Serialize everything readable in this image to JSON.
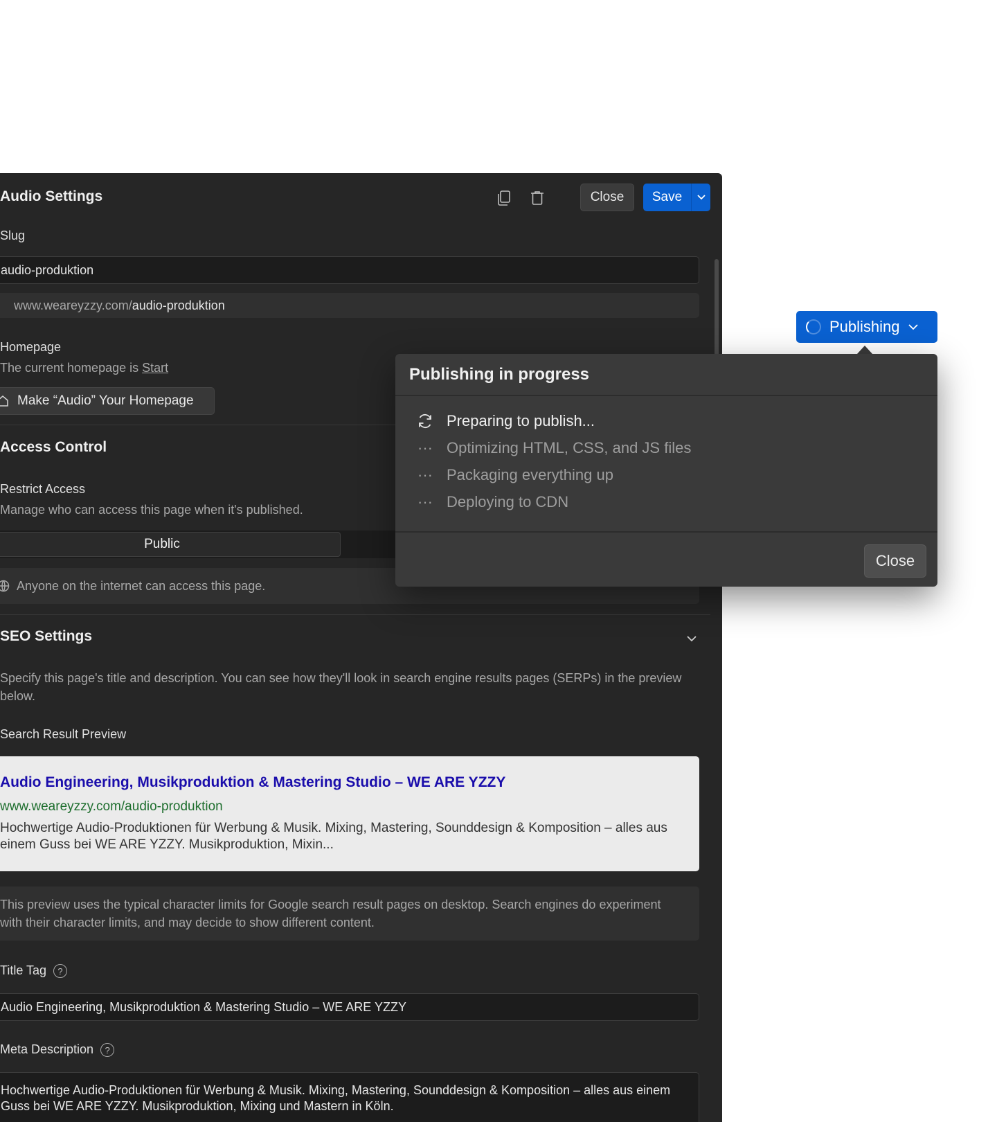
{
  "header": {
    "title": "Audio Settings",
    "close_label": "Close",
    "save_label": "Save"
  },
  "slug": {
    "label": "Slug",
    "value": "audio-produktion",
    "url_base": "www.weareyzzy.com/",
    "url_slug": "audio-produktion"
  },
  "homepage": {
    "label": "Homepage",
    "current_prefix": "The current homepage is ",
    "current_page": "Start",
    "make_button": "Make “Audio” Your Homepage"
  },
  "access": {
    "title": "Access Control",
    "restrict_label": "Restrict Access",
    "restrict_help": "Manage who can access this page when it's published.",
    "option_public": "Public",
    "info": "Anyone on the internet can access this page."
  },
  "seo": {
    "title": "SEO Settings",
    "description": "Specify this page's title and description. You can see how they'll look in search engine results pages (SERPs) in the preview below.",
    "preview_label": "Search Result Preview",
    "serp_title": "Audio Engineering, Musikproduktion & Mastering Studio – WE ARE YZZY",
    "serp_url": "www.weareyzzy.com/audio-produktion",
    "serp_desc": "Hochwertige Audio-Produktionen für Werbung & Musik. Mixing, Mastering, Sounddesign & Komposition – alles aus einem Guss bei WE ARE YZZY. Musikproduktion, Mixin...",
    "note": "This preview uses the typical character limits for Google search result pages on desktop. Search engines do experiment with their character limits, and may decide to show different content.",
    "title_tag_label": "Title Tag",
    "title_tag_value": "Audio Engineering, Musikproduktion & Mastering Studio – WE ARE YZZY",
    "meta_label": "Meta Description",
    "meta_value": "Hochwertige Audio-Produktionen für Werbung & Musik. Mixing, Mastering, Sounddesign & Komposition – alles aus einem Guss bei WE ARE YZZY. Musikproduktion, Mixing und Mastern in Köln."
  },
  "publish": {
    "button_label": "Publishing",
    "popover_title": "Publishing in progress",
    "steps": [
      {
        "label": "Preparing to publish...",
        "status": "active",
        "icon": "sync-icon"
      },
      {
        "label": "Optimizing HTML, CSS, and JS files",
        "status": "pending",
        "icon": "ellipsis-icon"
      },
      {
        "label": "Packaging everything up",
        "status": "pending",
        "icon": "ellipsis-icon"
      },
      {
        "label": "Deploying to CDN",
        "status": "pending",
        "icon": "ellipsis-icon"
      }
    ],
    "close_label": "Close"
  },
  "colors": {
    "accent": "#0a61d1",
    "panel_bg": "#262626",
    "popover_bg": "#3a3a3a",
    "serp_title": "#1a0dab",
    "serp_url": "#1e6e2e"
  }
}
